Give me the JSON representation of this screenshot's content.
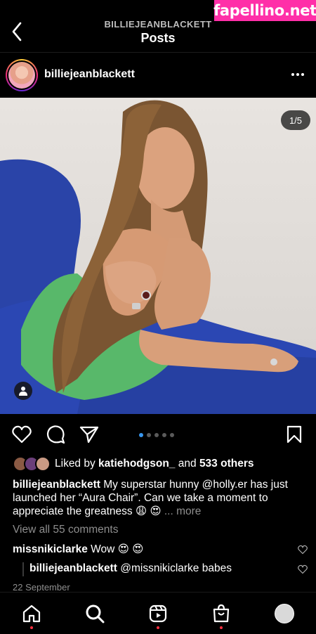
{
  "watermark": "fapellino.net",
  "header": {
    "account": "BILLIEJEANBLACKETT",
    "title": "Posts"
  },
  "post": {
    "username": "billiejeanblackett",
    "counter": "1/5",
    "carousel": {
      "current": 1,
      "total": 5
    },
    "likes": {
      "prefix": "Liked by",
      "user": "katiehodgson_",
      "middle": "and",
      "others": "533 others"
    },
    "caption": {
      "username": "billiejeanblackett",
      "text": "My superstar hunny @holly.er has just launched her “Aura Chair”. Can we take a moment to appreciate the greatness 😩 😍",
      "more": "... more"
    },
    "view_comments": "View all 55 comments",
    "comments": [
      {
        "username": "missnikiclarke",
        "text": "Wow 😍 😍"
      },
      {
        "username": "billiejeanblackett",
        "text": "@missnikiclarke babes"
      }
    ],
    "date": "22 September"
  },
  "icons": {
    "back": "chevron-left-icon",
    "more": "more-horizontal-icon",
    "like": "heart-icon",
    "comment": "comment-icon",
    "share": "send-icon",
    "save": "bookmark-icon",
    "tagged": "person-icon"
  },
  "colors": {
    "background": "#000000",
    "accent": "#3897f0",
    "notification": "#ff3040",
    "muted": "#8e8e8e"
  }
}
